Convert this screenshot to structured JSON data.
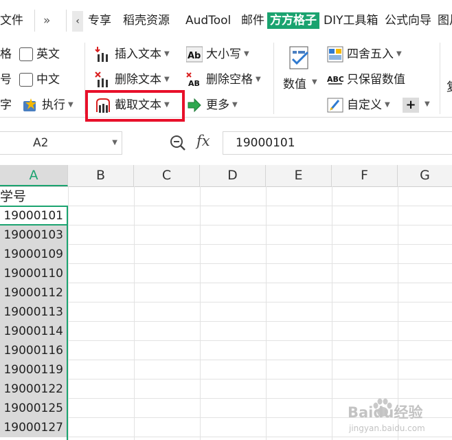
{
  "menu": {
    "items": [
      "文件",
      "专享",
      "稻壳资源",
      "AudTool",
      "邮件",
      "方方格子",
      "DIY工具箱",
      "公式向导",
      "图片"
    ],
    "active": "方方格子",
    "more_label": "»",
    "left_chevron": "‹"
  },
  "ribbon": {
    "check_col": {
      "row1_partial": "格",
      "row2_partial": "号",
      "row3_partial": "字",
      "english_label": "英文",
      "chinese_label": "中文",
      "execute_label": "执行"
    },
    "text_group": {
      "insert_text": "插入文本",
      "delete_text": "删除文本",
      "extract_text": "截取文本"
    },
    "case_group": {
      "case_label": "大小写",
      "remove_spaces": "删除空格",
      "more_label": "更多"
    },
    "number_group": {
      "numeric_label": "数值",
      "round_label": "四舍五入",
      "keep_values": "只保留数值",
      "custom_label": "自定义",
      "plus_label": "+"
    },
    "right_partial": "复",
    "accent_red": "#e8102a"
  },
  "formula_bar": {
    "name_box": "A2",
    "fx_label": "fx",
    "value": "19000101"
  },
  "grid": {
    "columns": [
      "A",
      "B",
      "C",
      "D",
      "E",
      "F",
      "G"
    ],
    "selected_column": "A",
    "header_cell": "学号",
    "values": [
      "19000101",
      "19000103",
      "19000109",
      "19000110",
      "19000112",
      "19000113",
      "19000114",
      "19000116",
      "19000119",
      "19000122",
      "19000125",
      "19000127"
    ]
  },
  "colors": {
    "accent_green": "#1aa36f",
    "selection_gray": "#d9d9d9"
  },
  "watermark": {
    "brand": "Baidu经验",
    "url": "jingyan.baidu.com"
  }
}
